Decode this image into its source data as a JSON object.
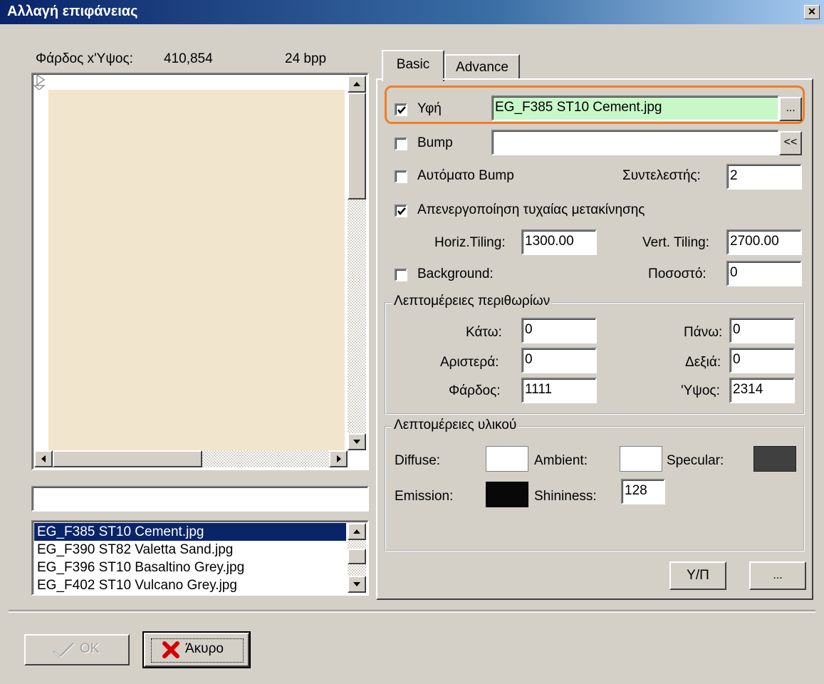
{
  "window": {
    "title": "Αλλαγή επιφάνειας",
    "close_glyph": "✕"
  },
  "preview": {
    "size_label": "Φάρδος x'Υψος:",
    "size_value": "410,854",
    "bpp": "24 bpp",
    "image_color": "#f1e5cd"
  },
  "file_filter": {
    "value": ""
  },
  "file_list": {
    "items": [
      "EG_F385 ST10 Cement.jpg",
      "EG_F390 ST82 Valetta Sand.jpg",
      "EG_F396 ST10 Basaltino Grey.jpg",
      "EG_F402 ST10 Vulcano Grey.jpg"
    ],
    "selected_index": 0
  },
  "tabs": [
    {
      "label": "Basic",
      "active": true
    },
    {
      "label": "Advance",
      "active": false
    }
  ],
  "basic": {
    "texture": {
      "label": "Υφή",
      "checked": true,
      "value": "EG_F385 ST10 Cement.jpg",
      "browse": "...",
      "highlight": "#f07d28",
      "field_bg": "#c8f8c8"
    },
    "bump": {
      "label": "Bump",
      "checked": false,
      "value": "",
      "button": "<<"
    },
    "auto_bump": {
      "label": "Αυτόματο Bump",
      "checked": false
    },
    "coefficient": {
      "label": "Συντελεστής:",
      "value": "2"
    },
    "disable_random": {
      "label": "Απενεργοποίηση τυχαίας μετακίνησης",
      "checked": true
    },
    "horiz_tiling": {
      "label": "Horiz.Tiling:",
      "value": "1300.00"
    },
    "vert_tiling": {
      "label": "Vert. Tiling:",
      "value": "2700.00"
    },
    "background": {
      "label": "Background:",
      "checked": false
    },
    "percent": {
      "label": "Ποσοστό:",
      "value": "0"
    },
    "margins": {
      "title": "Λεπτομέρειες περιθωρίων",
      "bottom": {
        "label": "Κάτω:",
        "value": "0"
      },
      "top": {
        "label": "Πάνω:",
        "value": "0"
      },
      "left": {
        "label": "Αριστερά:",
        "value": "0"
      },
      "right": {
        "label": "Δεξιά:",
        "value": "0"
      },
      "width": {
        "label": "Φάρδος:",
        "value": "1111"
      },
      "height": {
        "label": "'Υψος:",
        "value": "2314"
      }
    },
    "material": {
      "title": "Λεπτομέρειες υλικού",
      "diffuse": {
        "label": "Diffuse:",
        "color": "#ffffff"
      },
      "ambient": {
        "label": "Ambient:",
        "color": "#ffffff"
      },
      "specular": {
        "label": "Specular:",
        "color": "#404040"
      },
      "emission": {
        "label": "Emission:",
        "color": "#080808"
      },
      "shininess": {
        "label": "Shininess:",
        "value": "128"
      }
    },
    "yp_button": "Υ/Π",
    "more_button": "..."
  },
  "footer": {
    "ok": {
      "label": "OK",
      "enabled": false,
      "icon": "check-icon"
    },
    "cancel": {
      "label": "Άκυρο",
      "icon": "red-x-icon",
      "icon_color": "#d40000"
    }
  }
}
